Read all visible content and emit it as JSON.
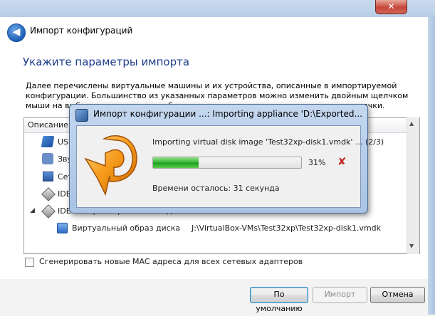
{
  "window": {
    "title": "Импорт конфигураций",
    "close_glyph": "✕"
  },
  "wizard": {
    "heading": "Укажите параметры импорта",
    "description": "Далее перечислены виртуальные машины и их устройства, описанные в импортируемой конфигурации. Большинство из указанных параметров можно изменить двойным щелчком мыши на выбранном элементе, либо отключить используя соответствующие галочки.",
    "tree": {
      "column_header": "Описание",
      "rows": [
        {
          "icon": "usb-icon",
          "label": "USB"
        },
        {
          "icon": "sound-card-icon",
          "label": "Зву"
        },
        {
          "icon": "network-adapter-icon",
          "label": "Сет"
        },
        {
          "icon": "ide-controller-icon",
          "label": "IDE"
        },
        {
          "icon": "ide-controller-icon",
          "label": "IDE-контроллер жесткого диска   PIIX4"
        },
        {
          "icon": "virtual-disk-icon",
          "label": "Виртуальный образ диска",
          "value": "J:\\VirtualBox-VMs\\Test32xp\\Test32xp-disk1.vmdk"
        }
      ]
    },
    "mac_checkbox_label": "Сгенерировать новые MAC адреса для всех сетевых адаптеров",
    "mac_checkbox_checked": false,
    "buttons": {
      "defaults": "По умолчанию",
      "import": "Импорт",
      "cancel": "Отмена"
    }
  },
  "progress_dialog": {
    "title": "Импорт конфигурации ...: Importing appliance 'D:\\Exported...",
    "operation": "Importing virtual disk image 'Test32xp-disk1.vmdk' ... (2/3)",
    "percent": 31,
    "percent_label": "31%",
    "time_remaining": "Времени осталось: 31 секунда",
    "cancel_glyph": "✘"
  },
  "colors": {
    "heading": "#1b3c8b",
    "progress": "#37b93a",
    "cancel": "#c42b2b"
  }
}
